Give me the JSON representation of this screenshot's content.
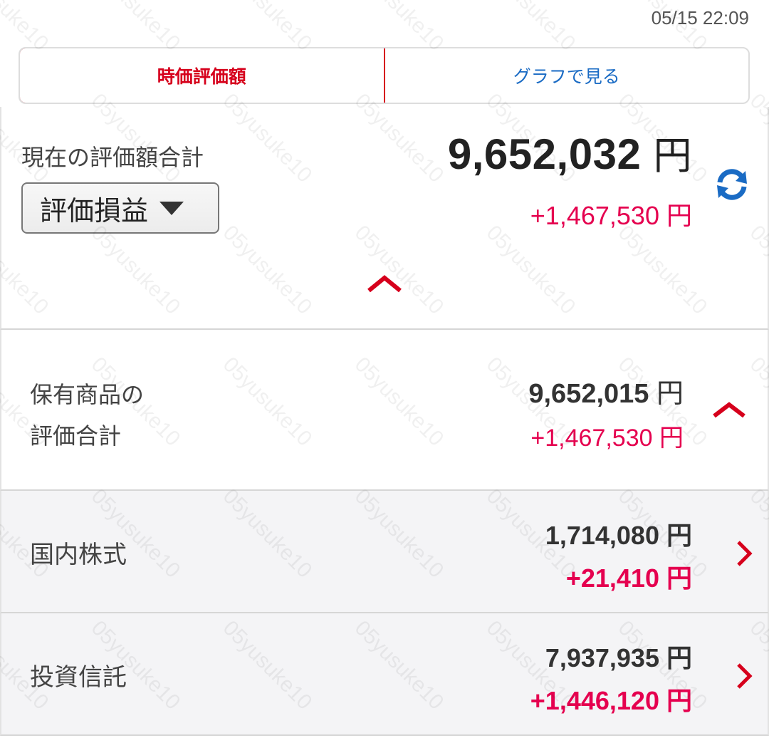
{
  "timestamp": "05/15 22:09",
  "tabs": [
    {
      "label": "時価評価額",
      "active": true
    },
    {
      "label": "グラフで見る",
      "active": false
    }
  ],
  "summary": {
    "label": "現在の評価額合計",
    "dropdown_label": "評価損益",
    "total_value": "9,652,032",
    "total_gain": "+1,467,530",
    "unit": "円"
  },
  "holdings": {
    "label_line1": "保有商品の",
    "label_line2": "評価合計",
    "value": "9,652,015",
    "gain": "+1,467,530",
    "unit": "円"
  },
  "rows": [
    {
      "label": "国内株式",
      "value": "1,714,080",
      "gain": "+21,410",
      "unit": "円"
    },
    {
      "label": "投資信託",
      "value": "7,937,935",
      "gain": "+1,446,120",
      "unit": "円"
    }
  ],
  "watermark_text": "05yusuke10",
  "colors": {
    "accent_red": "#d6001c",
    "gain_pink": "#e5004f",
    "link_blue": "#1a6bc4",
    "refresh_blue": "#1a6bc4"
  },
  "icons": {
    "refresh": "refresh-icon",
    "collapse": "chevron-up-icon",
    "navigate": "chevron-right-icon",
    "dropdown": "triangle-down-icon"
  }
}
